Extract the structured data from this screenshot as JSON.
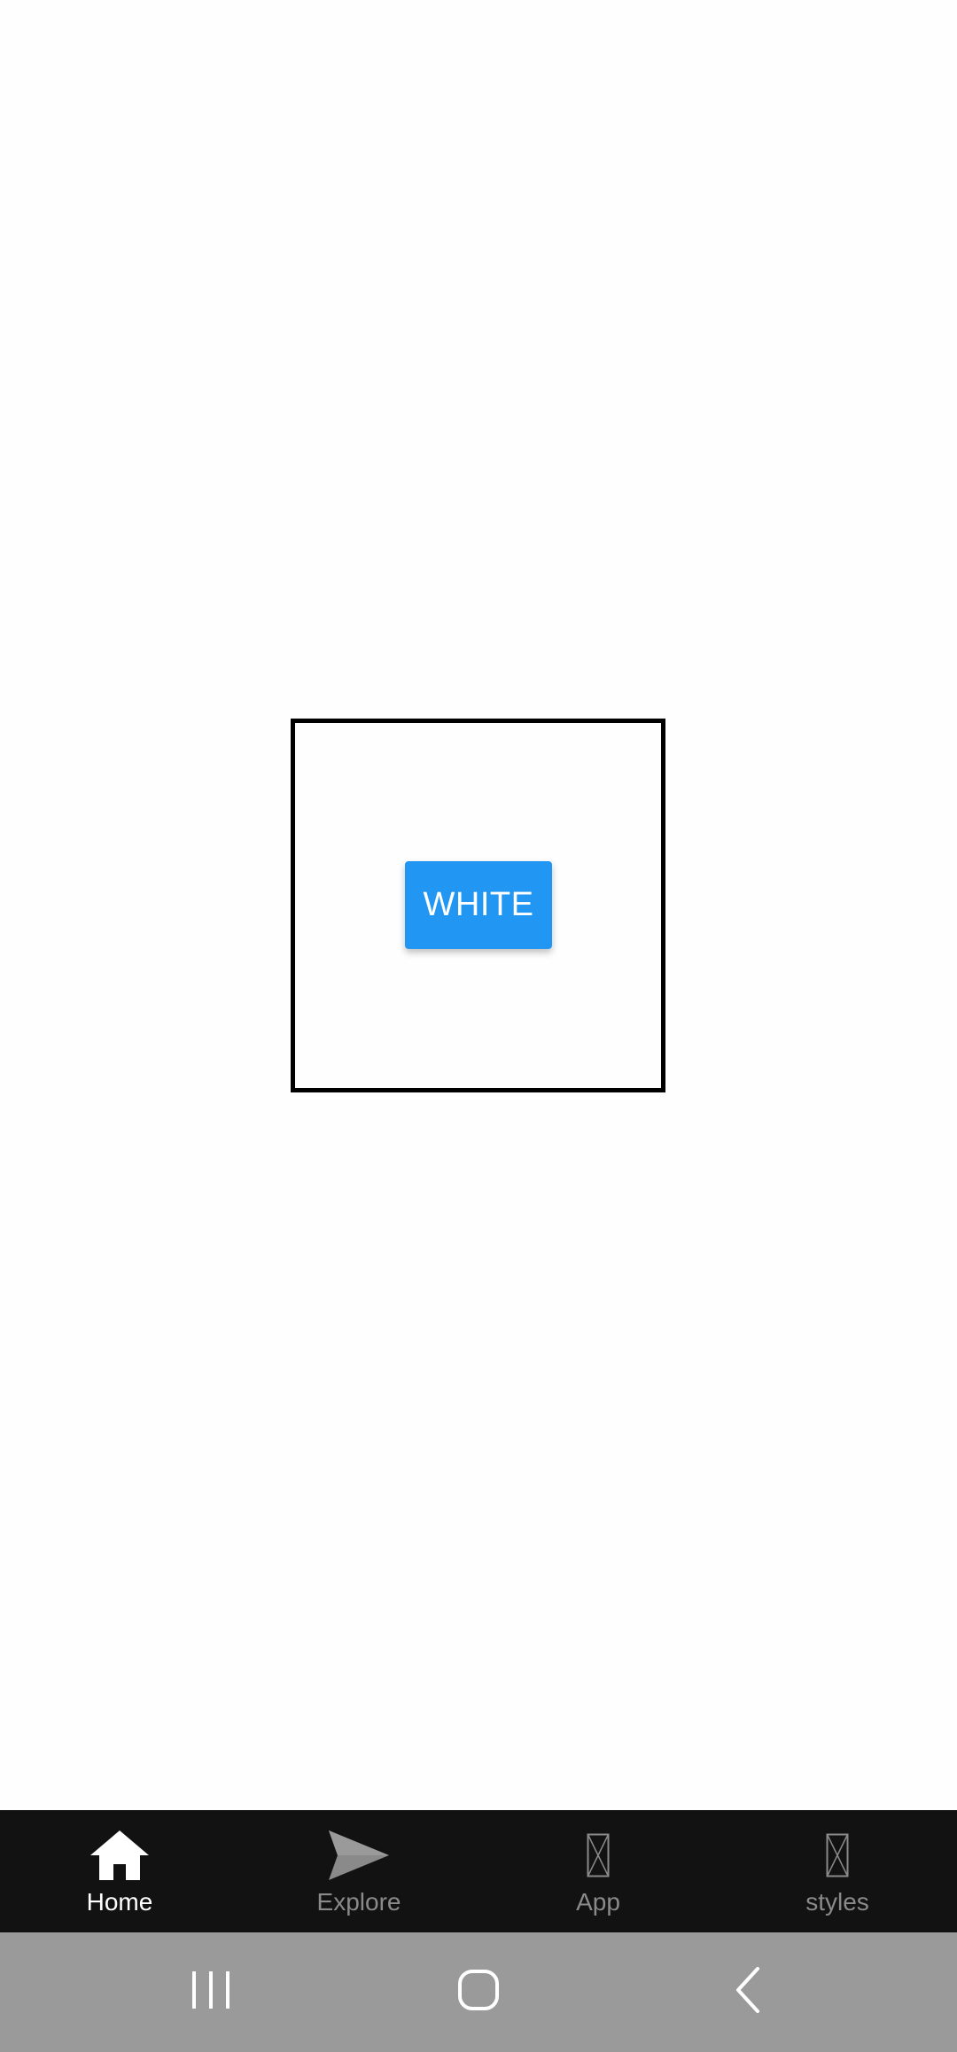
{
  "main": {
    "button_label": "WHITE"
  },
  "tab_bar": {
    "tabs": [
      {
        "label": "Home",
        "icon": "home-icon",
        "active": true
      },
      {
        "label": "Explore",
        "icon": "send-icon",
        "active": false
      },
      {
        "label": "App",
        "icon": "missing-glyph-icon",
        "active": false
      },
      {
        "label": "styles",
        "icon": "missing-glyph-icon",
        "active": false
      }
    ]
  },
  "system_nav": {
    "buttons": [
      "recent-apps",
      "home",
      "back"
    ]
  },
  "colors": {
    "accent": "#2196f3",
    "tab_bar_bg": "#121212",
    "nav_bar_bg": "#9a9a9a",
    "tab_active": "#ffffff",
    "tab_inactive": "#8a8a8a"
  }
}
